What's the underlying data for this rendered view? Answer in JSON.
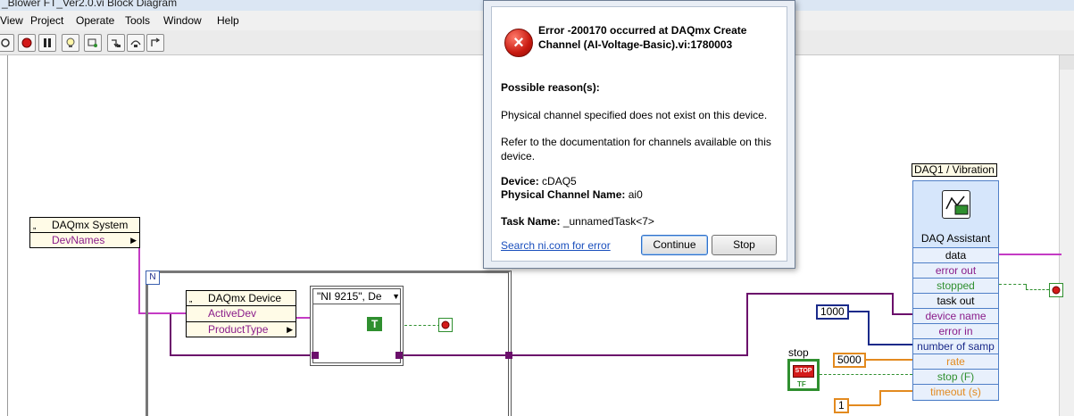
{
  "window": {
    "title": "_Blower FT_Ver2.0.vi Block Diagram"
  },
  "menu": {
    "items": [
      "View",
      "Project",
      "Operate",
      "Tools",
      "Window",
      "Help"
    ]
  },
  "toolbar": {
    "buttons": [
      "run-continuous",
      "abort",
      "pause",
      "highlight-execution",
      "retain-wire-values",
      "step-into",
      "step-over",
      "step-out"
    ]
  },
  "diagram": {
    "daqmx_system": {
      "header": "DAQmx System",
      "property": "DevNames"
    },
    "daqmx_device": {
      "header": "DAQmx Device",
      "properties": [
        "ActiveDev",
        "ProductType"
      ]
    },
    "case_selector": "\"NI 9215\", De",
    "true_constant": "T",
    "const_1000": "1000",
    "const_5000": "5000",
    "const_1": "1",
    "stop_label": "stop",
    "stop_button_text": "STOP",
    "stop_tf": "TF",
    "daq_label": "DAQ1 / Vibration",
    "daq_title": "DAQ Assistant",
    "daq_terminals": [
      "data",
      "error out",
      "stopped",
      "task out",
      "device name",
      "error in",
      "number of samp",
      "rate",
      "stop (F)",
      "timeout (s)"
    ],
    "loop_index": "N"
  },
  "dialog": {
    "error_title": "Error -200170 occurred at DAQmx Create Channel (AI-Voltage-Basic).vi:1780003",
    "possible_reasons_label": "Possible reason(s):",
    "reason_1": "Physical channel specified does not exist on this device.",
    "reason_2": "Refer to the documentation for channels available on this device.",
    "device_label": "Device:",
    "device_value": "cDAQ5",
    "channel_label": "Physical Channel Name:",
    "channel_value": "ai0",
    "task_label": "Task Name:",
    "task_value": "_unnamedTask<7>",
    "search_link": "Search ni.com for error",
    "continue_button": "Continue",
    "stop_button": "Stop"
  },
  "colors": {
    "error_red": "#c81a10",
    "dialog_link": "#1a4fbd",
    "wire_pink": "#c43bc4",
    "wire_orange": "#e38a1f",
    "wire_blue": "#1a2a8a",
    "daq_blue": "#d6e6fb"
  }
}
